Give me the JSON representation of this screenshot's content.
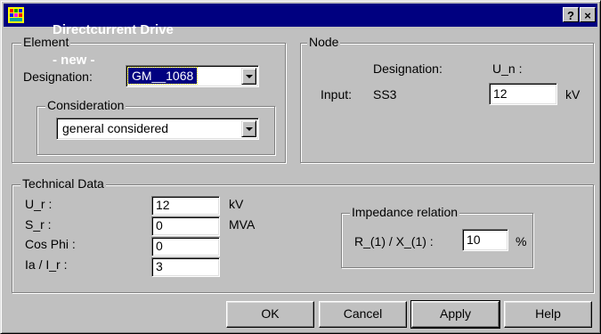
{
  "window": {
    "title": "Directcurrent Drive",
    "subtitle": "- new -",
    "help_button": "?",
    "close_button": "×"
  },
  "element": {
    "legend": "Element",
    "designation_label": "Designation:",
    "designation_value": "GM__1068",
    "consideration_legend": "Consideration",
    "consideration_value": "general considered"
  },
  "node": {
    "legend": "Node",
    "designation_header": "Designation:",
    "un_header": "U_n :",
    "input_label": "Input:",
    "input_designation": "SS3",
    "un_value": "12",
    "un_unit": "kV"
  },
  "technical": {
    "legend": "Technical Data",
    "rows": [
      {
        "label": "U_r :",
        "value": "12",
        "unit": "kV"
      },
      {
        "label": "S_r :",
        "value": "0",
        "unit": "MVA"
      },
      {
        "label": "Cos Phi :",
        "value": "0",
        "unit": ""
      },
      {
        "label": "Ia / I_r :",
        "value": "3",
        "unit": ""
      }
    ],
    "impedance_legend": "Impedance relation",
    "impedance_label": "R_(1) / X_(1) :",
    "impedance_value": "10",
    "impedance_unit": "%"
  },
  "buttons": {
    "ok": "OK",
    "cancel": "Cancel",
    "apply": "Apply",
    "help": "Help"
  }
}
